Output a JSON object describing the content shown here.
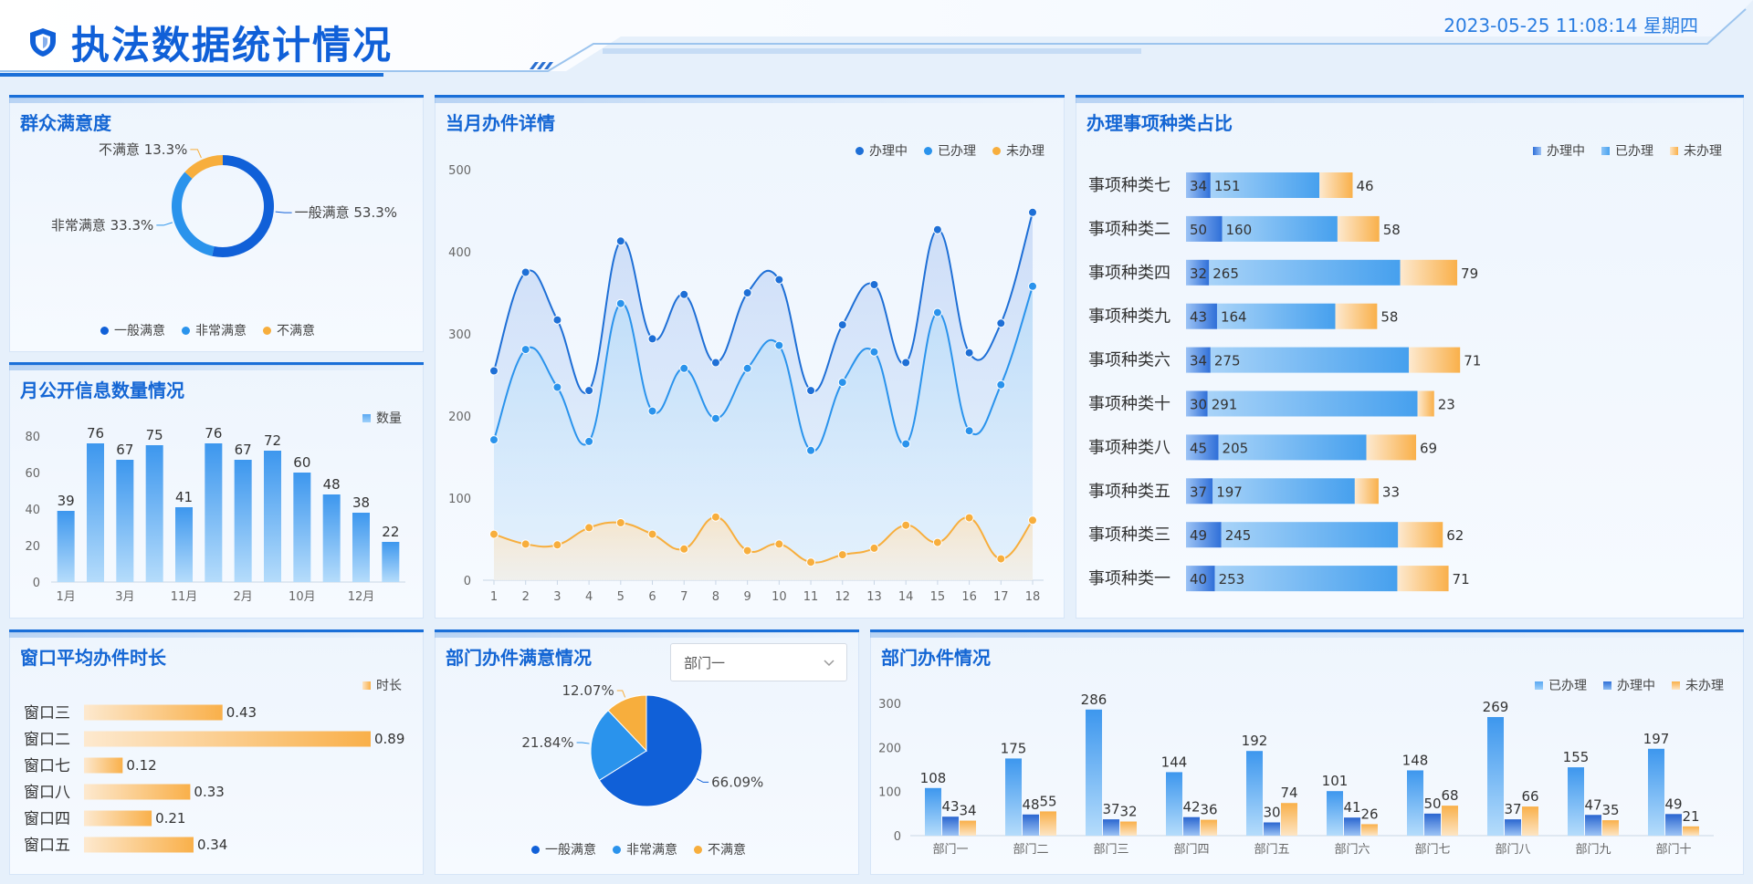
{
  "header": {
    "title": "执法数据统计情况",
    "datetime": "2023-05-25 11:08:14 星期四",
    "brand_color": "#1060d8"
  },
  "satisfaction": {
    "title": "群众满意度",
    "slices": [
      {
        "name": "一般满意",
        "pct_label": "一般满意 53.3%",
        "value": 53.3,
        "color": "#1060d8"
      },
      {
        "name": "非常满意",
        "pct_label": "非常满意 33.3%",
        "value": 33.3,
        "color": "#2a93ec"
      },
      {
        "name": "不满意",
        "pct_label": "不满意 13.3%",
        "value": 13.3,
        "color": "#f7ae3d"
      }
    ],
    "legend": [
      "一般满意",
      "非常满意",
      "不满意"
    ]
  },
  "monthly_info": {
    "title": "月公开信息数量情况",
    "legend": "数量",
    "y_ticks": [
      "0",
      "20",
      "40",
      "60",
      "80"
    ],
    "x_labels": [
      "1月",
      "3月",
      "11月",
      "2月",
      "10月",
      "12月"
    ],
    "values": [
      39,
      76,
      67,
      75,
      41,
      76,
      67,
      72,
      60,
      48,
      38,
      22
    ],
    "value_labels": [
      "39",
      "76",
      "67",
      "75",
      "41",
      "76",
      "67",
      "72",
      "60",
      "48",
      "38",
      "22"
    ]
  },
  "monthly_detail": {
    "title": "当月办件详情",
    "legend": [
      "办理中",
      "已办理",
      "未办理"
    ],
    "colors": [
      "#1e6fd6",
      "#2a93ec",
      "#f7ae3d"
    ],
    "y_ticks": [
      "0",
      "100",
      "200",
      "300",
      "400",
      "500"
    ],
    "x_labels": [
      "1",
      "2",
      "3",
      "4",
      "5",
      "6",
      "7",
      "8",
      "9",
      "10",
      "11",
      "12",
      "13",
      "14",
      "15",
      "16",
      "17",
      "18"
    ]
  },
  "chart_data": [
    {
      "type": "pie",
      "title": "群众满意度",
      "categories": [
        "一般满意",
        "非常满意",
        "不满意"
      ],
      "values": [
        53.3,
        33.3,
        13.3
      ]
    },
    {
      "type": "bar",
      "title": "月公开信息数量情况",
      "categories": [
        "1月",
        "",
        "3月",
        "",
        "11月",
        "",
        "2月",
        "",
        "10月",
        "",
        "12月",
        ""
      ],
      "values": [
        39,
        76,
        67,
        75,
        41,
        76,
        67,
        72,
        60,
        48,
        38,
        22
      ],
      "ylim": [
        0,
        80
      ]
    },
    {
      "type": "line",
      "title": "当月办件详情",
      "x": [
        1,
        2,
        3,
        4,
        5,
        6,
        7,
        8,
        9,
        10,
        11,
        12,
        13,
        14,
        15,
        16,
        17,
        18
      ],
      "series": [
        {
          "name": "办理中",
          "values": [
            255,
            375,
            317,
            231,
            413,
            294,
            348,
            265,
            350,
            366,
            231,
            311,
            360,
            265,
            427,
            277,
            313,
            448
          ]
        },
        {
          "name": "已办理",
          "values": [
            171,
            281,
            235,
            169,
            337,
            206,
            258,
            197,
            258,
            286,
            158,
            241,
            278,
            166,
            326,
            182,
            238,
            358
          ]
        },
        {
          "name": "未办理",
          "values": [
            56,
            44,
            43,
            64,
            70,
            56,
            38,
            77,
            36,
            44,
            22,
            31,
            39,
            67,
            46,
            76,
            26,
            73
          ]
        }
      ],
      "ylim": [
        0,
        500
      ]
    },
    {
      "type": "bar",
      "title": "办理事项种类占比",
      "categories": [
        "事项种类七",
        "事项种类二",
        "事项种类四",
        "事项种类九",
        "事项种类六",
        "事项种类十",
        "事项种类八",
        "事项种类五",
        "事项种类三",
        "事项种类一"
      ],
      "series": [
        {
          "name": "办理中",
          "values": [
            34,
            50,
            32,
            43,
            34,
            30,
            45,
            37,
            49,
            40
          ]
        },
        {
          "name": "已办理",
          "values": [
            151,
            160,
            265,
            164,
            275,
            291,
            205,
            197,
            245,
            253
          ]
        },
        {
          "name": "未办理",
          "values": [
            46,
            58,
            79,
            58,
            71,
            23,
            69,
            33,
            62,
            71
          ]
        }
      ]
    },
    {
      "type": "bar",
      "title": "窗口平均办件时长",
      "categories": [
        "窗口三",
        "窗口二",
        "窗口七",
        "窗口八",
        "窗口四",
        "窗口五"
      ],
      "values": [
        0.43,
        0.89,
        0.12,
        0.33,
        0.21,
        0.34
      ]
    },
    {
      "type": "pie",
      "title": "部门办件满意情况",
      "categories": [
        "一般满意",
        "非常满意",
        "不满意"
      ],
      "values": [
        66.09,
        21.84,
        12.07
      ]
    },
    {
      "type": "bar",
      "title": "部门办件情况",
      "categories": [
        "部门一",
        "部门二",
        "部门三",
        "部门四",
        "部门五",
        "部门六",
        "部门七",
        "部门八",
        "部门九",
        "部门十"
      ],
      "series": [
        {
          "name": "已办理",
          "values": [
            108,
            175,
            286,
            144,
            192,
            101,
            148,
            269,
            155,
            197
          ]
        },
        {
          "name": "办理中",
          "values": [
            43,
            48,
            37,
            42,
            30,
            41,
            50,
            37,
            47,
            49
          ]
        },
        {
          "name": "未办理",
          "values": [
            34,
            55,
            32,
            36,
            74,
            26,
            68,
            66,
            35,
            21
          ]
        }
      ],
      "ylim": [
        0,
        300
      ]
    }
  ],
  "category_ratio": {
    "title": "办理事项种类占比",
    "legend": [
      "办理中",
      "已办理",
      "未办理"
    ]
  },
  "window_time": {
    "title": "窗口平均办件时长",
    "legend": "时长"
  },
  "dept_satisfaction": {
    "title": "部门办件满意情况",
    "select_value": "部门一",
    "legend": [
      "一般满意",
      "非常满意",
      "不满意"
    ],
    "labels": [
      "66.09%",
      "21.84%",
      "12.07%"
    ]
  },
  "dept_cases": {
    "title": "部门办件情况",
    "legend": [
      "已办理",
      "办理中",
      "未办理"
    ],
    "y_ticks": [
      "0",
      "100",
      "200",
      "300"
    ]
  }
}
